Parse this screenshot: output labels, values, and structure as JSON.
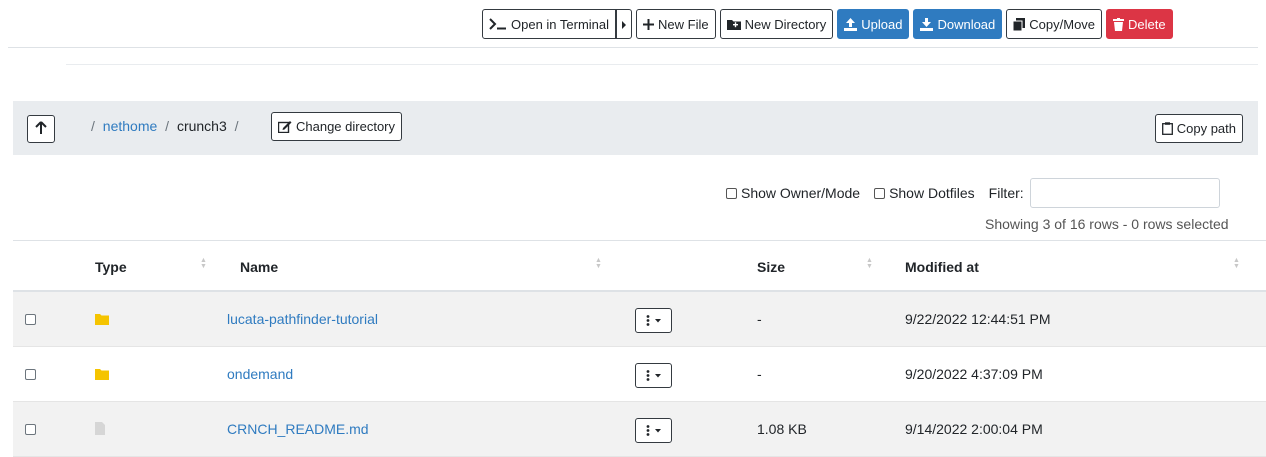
{
  "toolbar": {
    "open_terminal": "Open in Terminal",
    "new_file": "New File",
    "new_directory": "New Directory",
    "upload": "Upload",
    "download": "Download",
    "copy_move": "Copy/Move",
    "delete": "Delete"
  },
  "breadcrumb": {
    "root_sep": "/",
    "parts": [
      "nethome",
      "crunch3"
    ],
    "change_directory": "Change directory",
    "copy_path": "Copy path"
  },
  "options": {
    "show_owner_mode": "Show Owner/Mode",
    "show_dotfiles": "Show Dotfiles",
    "filter_label": "Filter:",
    "filter_value": ""
  },
  "rows_info": "Showing 3 of 16 rows - 0 rows selected",
  "table": {
    "headers": {
      "type": "Type",
      "name": "Name",
      "size": "Size",
      "modified": "Modified at"
    },
    "rows": [
      {
        "type": "folder",
        "name": "lucata-pathfinder-tutorial",
        "size": "-",
        "modified": "9/22/2022 12:44:51 PM"
      },
      {
        "type": "folder",
        "name": "ondemand",
        "size": "-",
        "modified": "9/20/2022 4:37:09 PM"
      },
      {
        "type": "file",
        "name": "CRNCH_README.md",
        "size": "1.08 KB",
        "modified": "9/14/2022 2:00:04 PM"
      }
    ]
  },
  "colors": {
    "primary": "#2f7bc0",
    "danger": "#dc3545",
    "folder": "#f5c400",
    "file": "#d6d6d6"
  }
}
